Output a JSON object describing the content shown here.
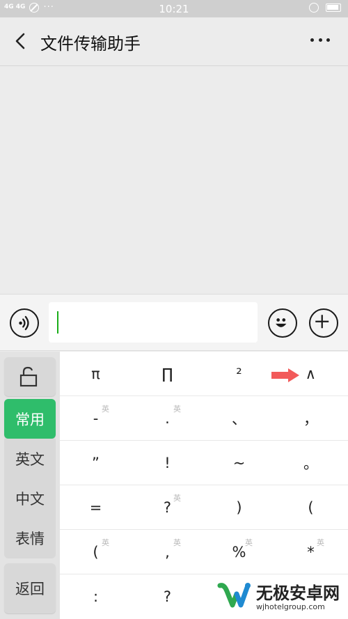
{
  "status_bar": {
    "network": "4G 4G",
    "time": "10:21",
    "dots": "···"
  },
  "header": {
    "title": "文件传输助手"
  },
  "icons": {
    "back": "chevron-left-icon",
    "more": "more-horizontal-icon",
    "voice": "voice-input-icon",
    "emoji": "emoji-icon",
    "plus": "plus-icon",
    "lock": "unlock-icon"
  },
  "keyboard": {
    "side": {
      "categories": [
        "常用",
        "英文",
        "中文",
        "表情"
      ],
      "back_label": "返回"
    },
    "rows": [
      [
        {
          "key": "π"
        },
        {
          "key": "∏"
        },
        {
          "key": "²"
        },
        {
          "key": "∧"
        }
      ],
      [
        {
          "key": "-",
          "tag": "英"
        },
        {
          "key": ".",
          "tag": "英"
        },
        {
          "key": "、"
        },
        {
          "key": "，"
        }
      ],
      [
        {
          "key": "”"
        },
        {
          "key": "!"
        },
        {
          "key": "~"
        },
        {
          "key": "。"
        }
      ],
      [
        {
          "key": "="
        },
        {
          "key": "?",
          "tag": "英"
        },
        {
          "key": ")"
        },
        {
          "key": "("
        }
      ],
      [
        {
          "key": "(",
          "tag": "英"
        },
        {
          "key": ",",
          "tag": "英"
        },
        {
          "key": "%",
          "tag": "英"
        },
        {
          "key": "*",
          "tag": "英"
        }
      ],
      [
        {
          "key": ":"
        },
        {
          "key": "?"
        },
        {
          "key": ""
        },
        {
          "key": ""
        }
      ]
    ]
  },
  "watermark": {
    "title": "无极安卓网",
    "url": "wjhotelgroup.com"
  },
  "colors": {
    "accent": "#2fbd6b",
    "cursor": "#1aad19",
    "arrow": "#f25a5a"
  }
}
